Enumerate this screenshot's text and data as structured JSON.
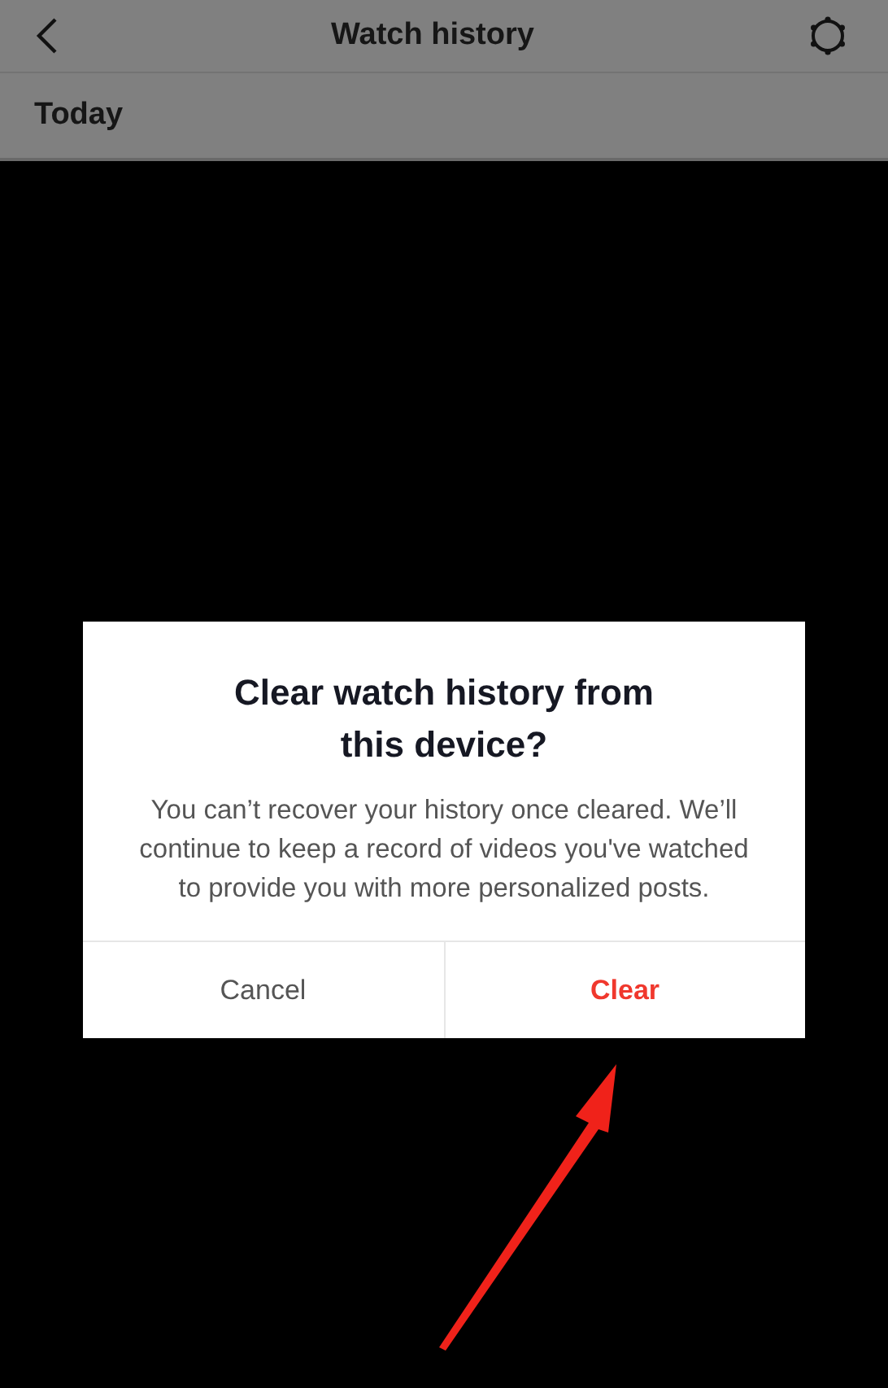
{
  "header": {
    "title": "Watch history"
  },
  "section": {
    "title": "Today"
  },
  "dialog": {
    "title_lines": [
      "Clear watch history from",
      "this device?"
    ],
    "message": "You can’t recover your history once cleared. We’ll continue to keep a record of videos you've watched to provide you with more personalized posts.",
    "buttons": [
      {
        "label": "Cancel",
        "kind": "cancel"
      },
      {
        "label": "Clear",
        "kind": "destructive"
      }
    ]
  }
}
